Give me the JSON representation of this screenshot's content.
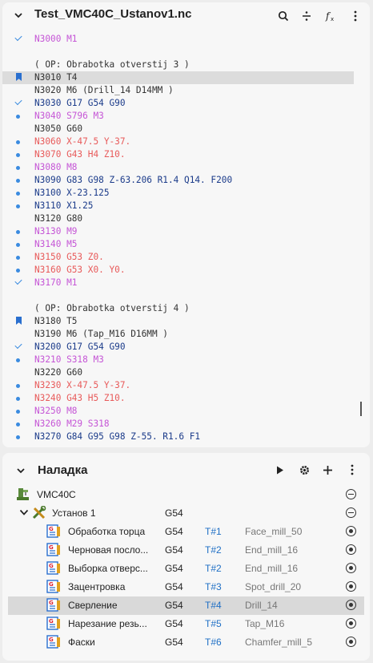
{
  "editor": {
    "title": "Test_VMC40C_Ustanov1.nc",
    "toolbar": {
      "search_icon": "search-icon",
      "split_icon": "split-icon",
      "formula_icon": "formula-icon",
      "more_icon": "more-icon"
    },
    "lines": [
      {
        "text": "N3000 M1",
        "color": "#c555d6",
        "marker": "check"
      },
      {
        "text": "",
        "color": "#333333",
        "marker": ""
      },
      {
        "text": "( OP: Obrabotka otverstij 3 )",
        "color": "#333333",
        "marker": ""
      },
      {
        "text": "N3010 T4",
        "color": "#333333",
        "marker": "bookmark",
        "highlight": true
      },
      {
        "text": "N3020 M6 (Drill_14 D14MM )",
        "color": "#333333",
        "marker": ""
      },
      {
        "text": "N3030 G17 G54 G90",
        "color": "#1b3b8a",
        "marker": "check"
      },
      {
        "text": "N3040 S796 M3",
        "color": "#c555d6",
        "marker": "dot"
      },
      {
        "text": "N3050 G60",
        "color": "#333333",
        "marker": ""
      },
      {
        "text": "N3060 X-47.5 Y-37.",
        "color": "#e85a5a",
        "marker": "dot"
      },
      {
        "text": "N3070 G43 H4 Z10.",
        "color": "#e85a5a",
        "marker": "dot"
      },
      {
        "text": "N3080 M8",
        "color": "#c555d6",
        "marker": "dot"
      },
      {
        "text": "N3090 G83 G98 Z-63.206 R1.4 Q14. F200",
        "color": "#1b3b8a",
        "marker": "dot"
      },
      {
        "text": "N3100 X-23.125",
        "color": "#1b3b8a",
        "marker": "dot"
      },
      {
        "text": "N3110 X1.25",
        "color": "#1b3b8a",
        "marker": "dot"
      },
      {
        "text": "N3120 G80",
        "color": "#333333",
        "marker": ""
      },
      {
        "text": "N3130 M9",
        "color": "#c555d6",
        "marker": "dot"
      },
      {
        "text": "N3140 M5",
        "color": "#c555d6",
        "marker": "dot"
      },
      {
        "text": "N3150 G53 Z0.",
        "color": "#e85a5a",
        "marker": "dot"
      },
      {
        "text": "N3160 G53 X0. Y0.",
        "color": "#e85a5a",
        "marker": "dot"
      },
      {
        "text": "N3170 M1",
        "color": "#c555d6",
        "marker": "check"
      },
      {
        "text": "",
        "color": "#333333",
        "marker": ""
      },
      {
        "text": "( OP: Obrabotka otverstij 4 )",
        "color": "#333333",
        "marker": ""
      },
      {
        "text": "N3180 T5",
        "color": "#333333",
        "marker": "bookmark"
      },
      {
        "text": "N3190 M6 (Tap_M16 D16MM )",
        "color": "#333333",
        "marker": ""
      },
      {
        "text": "N3200 G17 G54 G90",
        "color": "#1b3b8a",
        "marker": "check"
      },
      {
        "text": "N3210 S318 M3",
        "color": "#c555d6",
        "marker": "dot"
      },
      {
        "text": "N3220 G60",
        "color": "#333333",
        "marker": ""
      },
      {
        "text": "N3230 X-47.5 Y-37.",
        "color": "#e85a5a",
        "marker": "dot"
      },
      {
        "text": "N3240 G43 H5 Z10.",
        "color": "#e85a5a",
        "marker": "dot"
      },
      {
        "text": "N3250 M8",
        "color": "#c555d6",
        "marker": "dot"
      },
      {
        "text": "N3260 M29 S318",
        "color": "#c555d6",
        "marker": "dot"
      },
      {
        "text": "N3270 G84 G95 G98 Z-55. R1.6 F1",
        "color": "#1b3b8a",
        "marker": "dot"
      }
    ]
  },
  "setup": {
    "title": "Наладка",
    "machine": "VMC40C",
    "ustanov": {
      "name": "Установ 1",
      "wcs": "G54"
    },
    "operations": [
      {
        "name": "Обработка торца",
        "wcs": "G54",
        "tool": "T#1",
        "tool_name": "Face_mill_50"
      },
      {
        "name": "Черновая послo...",
        "wcs": "G54",
        "tool": "T#2",
        "tool_name": "End_mill_16"
      },
      {
        "name": "Выборка отверс...",
        "wcs": "G54",
        "tool": "T#2",
        "tool_name": "End_mill_16"
      },
      {
        "name": "Зацентровка",
        "wcs": "G54",
        "tool": "T#3",
        "tool_name": "Spot_drill_20"
      },
      {
        "name": "Сверление",
        "wcs": "G54",
        "tool": "T#4",
        "tool_name": "Drill_14",
        "selected": true
      },
      {
        "name": "Нарезание резь...",
        "wcs": "G54",
        "tool": "T#5",
        "tool_name": "Tap_M16"
      },
      {
        "name": "Фаски",
        "wcs": "G54",
        "tool": "T#6",
        "tool_name": "Chamfer_mill_5"
      }
    ]
  }
}
